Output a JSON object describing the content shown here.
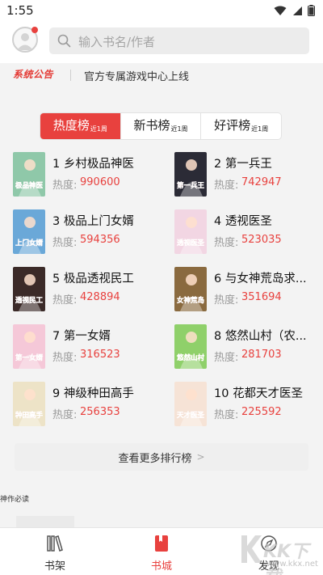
{
  "status_bar": {
    "time": "1:55"
  },
  "search": {
    "placeholder": "输入书名/作者"
  },
  "notice": {
    "tag": "系统公告",
    "text": "官方专属游戏中心上线"
  },
  "tabs": [
    {
      "label": "热度榜",
      "sub": "近1周",
      "active": true
    },
    {
      "label": "新书榜",
      "sub": "近1周",
      "active": false
    },
    {
      "label": "好评榜",
      "sub": "近1周",
      "active": false
    }
  ],
  "heat_label": "热度:",
  "books": [
    {
      "rank": "1",
      "title": "乡村极品神医",
      "heat": "990600",
      "cover_color": "#8fc8a9",
      "cover_text": "极品神医"
    },
    {
      "rank": "2",
      "title": "第一兵王",
      "heat": "742947",
      "cover_color": "#2b2b36",
      "cover_text": "第一兵王"
    },
    {
      "rank": "3",
      "title": "极品上门女婿",
      "heat": "594356",
      "cover_color": "#6aa8d8",
      "cover_text": "上门女婿"
    },
    {
      "rank": "4",
      "title": "透视医圣",
      "heat": "523035",
      "cover_color": "#f2d6e3",
      "cover_text": "透视医圣"
    },
    {
      "rank": "5",
      "title": "极品透视民工",
      "heat": "428894",
      "cover_color": "#3b2a28",
      "cover_text": "透视民工"
    },
    {
      "rank": "6",
      "title": "与女神荒岛求...",
      "heat": "351694",
      "cover_color": "#8a6a3f",
      "cover_text": "女神荒岛"
    },
    {
      "rank": "7",
      "title": "第一女婿",
      "heat": "316523",
      "cover_color": "#f5c8d8",
      "cover_text": "第一女婿"
    },
    {
      "rank": "8",
      "title": "悠然山村（农...",
      "heat": "281703",
      "cover_color": "#8fd06a",
      "cover_text": "悠然山村"
    },
    {
      "rank": "9",
      "title": "神级种田高手",
      "heat": "256353",
      "cover_color": "#ede3c7",
      "cover_text": "种田高手"
    },
    {
      "rank": "10",
      "title": "花都天才医圣",
      "heat": "225592",
      "cover_color": "#f6e3d6",
      "cover_text": "天才医圣"
    }
  ],
  "more_link": "查看更多排行榜",
  "section_title": "神作必读",
  "nav": [
    {
      "label": "书架",
      "icon": "bookshelf-icon",
      "active": false
    },
    {
      "label": "书城",
      "icon": "bookstore-icon",
      "active": true
    },
    {
      "label": "发现",
      "icon": "discover-icon",
      "active": false
    }
  ],
  "watermark": {
    "text": "KK下载",
    "sub": "www.kkx.net"
  },
  "colors": {
    "accent": "#e8413e",
    "background": "#f3f3f3"
  }
}
